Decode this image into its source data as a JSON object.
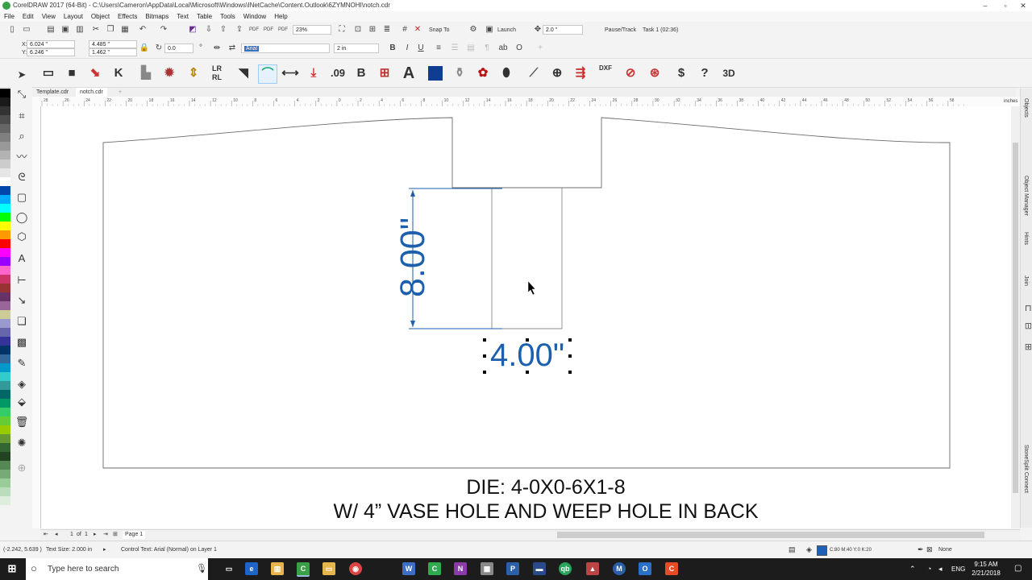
{
  "window": {
    "title": "CorelDRAW 2017 (64-Bit) - C:\\Users\\Cameron\\AppData\\Local\\Microsoft\\Windows\\INetCache\\Content.Outlook\\6ZYMNOHI\\notch.cdr",
    "controls": [
      "–",
      "▫",
      "✕"
    ]
  },
  "menu": [
    "File",
    "Edit",
    "View",
    "Layout",
    "Object",
    "Effects",
    "Bitmaps",
    "Text",
    "Table",
    "Tools",
    "Window",
    "Help"
  ],
  "toolbar": {
    "zoom": "23%",
    "snap_to": "Snap To",
    "launch": "Launch",
    "nudge": "2.0 \"",
    "pause_track": "Pause/Track",
    "task": "Task 1 (02:36)"
  },
  "property_bar": {
    "x": "6.024 \"",
    "y": "6.246 \"",
    "width": "4.485 \"",
    "height": "1.462 \"",
    "rotation": "0.0",
    "font": "Arial",
    "font_size": "2 in",
    "bold": "B",
    "italic": "I",
    "underline": "U"
  },
  "macro_toolbar": {
    "labels": [
      ".09",
      "B",
      "DXF",
      "$",
      "?",
      "3D"
    ]
  },
  "doc_tabs": [
    "Template.cdr",
    "notch.cdr",
    "+"
  ],
  "ruler": {
    "unit": "inches",
    "ticks": [
      "28",
      "26",
      "24",
      "22",
      "20",
      "18",
      "16",
      "14",
      "12",
      "10",
      "8",
      "6",
      "4",
      "2",
      "0",
      "2",
      "4",
      "6",
      "8",
      "10",
      "12",
      "14",
      "16",
      "18",
      "20",
      "22",
      "24",
      "26",
      "28",
      "30",
      "32",
      "34",
      "36",
      "38",
      "40",
      "42",
      "44",
      "46",
      "48",
      "50",
      "52",
      "54",
      "56",
      "58"
    ]
  },
  "canvas": {
    "dim_vertical": "8.00\"",
    "dim_horizontal": "4.00\"",
    "die_line1": "DIE: 4-0X0-6X1-8",
    "die_line2": "W/ 4” VASE HOLE AND WEEP HOLE IN BACK"
  },
  "dockers": [
    "Objects",
    "Object Manager",
    "Hints",
    "Join",
    "StoneSplit Connect"
  ],
  "page_nav": {
    "current": "1",
    "of": "of",
    "total": "1",
    "page_tab": "Page 1"
  },
  "status": {
    "coords": "(-2.242, 5.639 )",
    "text_size": "Text Size: 2.000  in",
    "info": "Control Text: Arial (Normal) on Layer 1",
    "fill": "C:80 M:40 Y:0 K:20",
    "outline": "None"
  },
  "taskbar": {
    "search_placeholder": "Type here to search",
    "time": "9:15 AM",
    "date": "2/21/2018",
    "lang": "ENG"
  },
  "colors": {
    "dimension_blue": "#1b5fad",
    "fill_swatch": "#1f5fb8"
  },
  "palette": [
    "#000000",
    "#1a1a1a",
    "#333333",
    "#4d4d4d",
    "#666666",
    "#808080",
    "#999999",
    "#b3b3b3",
    "#cccccc",
    "#e6e6e6",
    "#ffffff",
    "#0047ab",
    "#00aaff",
    "#00ffff",
    "#00ff00",
    "#ffff00",
    "#ff9900",
    "#ff0000",
    "#ff00ff",
    "#9900ff",
    "#ff66cc",
    "#cc3366",
    "#993333",
    "#663366",
    "#996699",
    "#cccc99",
    "#9999cc",
    "#6666aa",
    "#333399",
    "#003366",
    "#336699",
    "#0099cc",
    "#33cccc",
    "#339999",
    "#006666",
    "#009966",
    "#33cc66",
    "#66cc33",
    "#99cc00",
    "#669933",
    "#336633",
    "#224422",
    "#558855",
    "#77aa77",
    "#99cc99",
    "#bbddbb",
    "#ddeedd"
  ]
}
